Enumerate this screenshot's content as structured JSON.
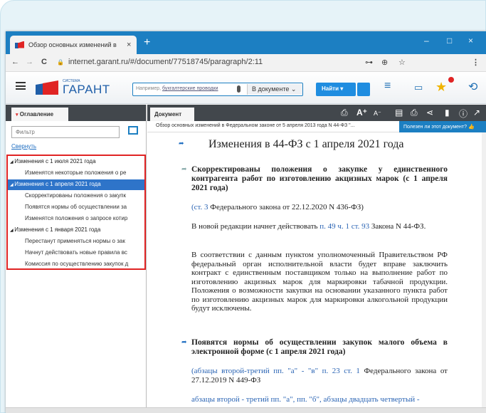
{
  "browser": {
    "tab_title": "Обзор основных изменений в",
    "tab_close": "×",
    "new_tab": "+",
    "url": "internet.garant.ru/#/document/77518745/paragraph/2:11",
    "window_controls": {
      "minimize": "–",
      "maximize": "□",
      "close": "×"
    },
    "nav": {
      "back": "←",
      "forward": "→",
      "reload": "C",
      "lock": "🔒"
    },
    "addr_icons": {
      "key": "⊶",
      "zoom": "⊕",
      "star": "☆",
      "menu": "⋮"
    }
  },
  "app": {
    "logo_small": "СИСТЕМА",
    "logo_text": "ГАРАНТ",
    "search": {
      "placeholder_prefix": "Например, ",
      "placeholder_link": "бухгалтерские проводки",
      "scope": "В документе",
      "find_label": "Найти"
    }
  },
  "left_panel": {
    "tab_label": "Оглавление",
    "tab_marker": "▾",
    "filter_placeholder": "Фильтр",
    "collapse_label": "Свернуть",
    "toc": [
      {
        "label": "Изменения с 1 июля 2021 года",
        "level": 1,
        "selected": false
      },
      {
        "label": "Изменятся некоторые положения о ре",
        "level": 2,
        "selected": false
      },
      {
        "label": "Изменения с 1 апреля 2021 года",
        "level": 1,
        "selected": true
      },
      {
        "label": "Скорректированы положения о закупк",
        "level": 2,
        "selected": false
      },
      {
        "label": "Появятся нормы об осуществлении за",
        "level": 2,
        "selected": false
      },
      {
        "label": "Изменятся положения о запросе котир",
        "level": 2,
        "selected": false
      },
      {
        "label": "Изменения с 1 января 2021 года",
        "level": 1,
        "selected": false
      },
      {
        "label": "Перестанут применяться нормы о зак",
        "level": 2,
        "selected": false
      },
      {
        "label": "Начнут действовать новые правила вс",
        "level": 2,
        "selected": false
      },
      {
        "label": "Комиссия по осуществлению закупок д",
        "level": 2,
        "selected": false
      }
    ]
  },
  "doc_panel": {
    "tab_label": "Документ",
    "toolbar_icons": {
      "print": "⎙",
      "font_up": "A⁺",
      "font_down": "A⁻",
      "share": "⋖",
      "bookmark": "▮",
      "info": "ⓘ",
      "export": "↗"
    },
    "crumb": "Обзор основных изменений в Федеральном законе от 5 апреля 2013 года N 44-ФЗ \"...",
    "ask_label": "Полезен ли этот документ?"
  },
  "document": {
    "title": "Изменения в 44-ФЗ с 1 апреля 2021 года",
    "section1_heading": "Скорректированы положения о закупке у единственного контрагента работ по изготовлению акцизных марок (с 1 апреля 2021 года)",
    "p1_link": "(ст. 3",
    "p1_text": " Федерального закона от 22.12.2020 N 436-ФЗ)",
    "p2_text": "В новой редакции начнет действовать ",
    "p2_link": "п. 49 ч. 1 ст. 93",
    "p2_text2": " Закона N 44-ФЗ.",
    "p3_text": "В соответствии с данным пунктом уполномоченный Правительством РФ федеральный орган исполнительной власти будет вправе заключить контракт с единственным поставщиком только на выполнение работ по изготовлению акцизных марок для маркировки табачной продукции. Положения о возможности закупки на основании указанного пункта работ по изготовлению акцизных марок для маркировки алкогольной продукции будут исключены.",
    "section2_heading": "Появятся нормы об осуществлении закупок малого объема в электронной форме (с 1 апреля 2021 года)",
    "p4_link": "(абзацы второй-третий пп. \"а\" - \"в\" п. 23 ст. 1",
    "p4_text": " Федерального закона от 27.12.2019 N 449-ФЗ",
    "p5_link": "абзацы второй - третий пп. \"а\", пп. \"б\", абзацы двадцать четвертый -"
  }
}
